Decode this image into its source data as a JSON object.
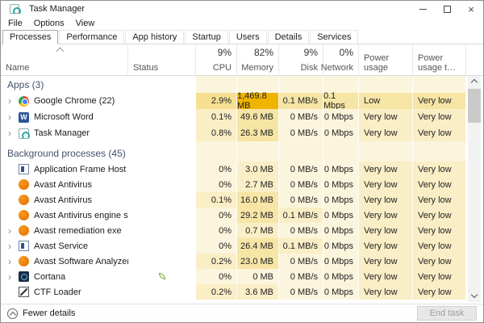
{
  "window": {
    "title": "Task Manager"
  },
  "menu": {
    "items": [
      "File",
      "Options",
      "View"
    ]
  },
  "tabs": [
    {
      "label": "Processes",
      "active": true
    },
    {
      "label": "Performance",
      "active": false
    },
    {
      "label": "App history",
      "active": false
    },
    {
      "label": "Startup",
      "active": false
    },
    {
      "label": "Users",
      "active": false
    },
    {
      "label": "Details",
      "active": false
    },
    {
      "label": "Services",
      "active": false
    }
  ],
  "columns": {
    "name": "Name",
    "status": "Status",
    "cpu": {
      "pct": "9%",
      "label": "CPU"
    },
    "memory": {
      "pct": "82%",
      "label": "Memory"
    },
    "disk": {
      "pct": "9%",
      "label": "Disk"
    },
    "network": {
      "pct": "0%",
      "label": "Network"
    },
    "power": "Power usage",
    "trend": "Power usage t…",
    "sort_column": "Name",
    "sort_direction": "ascending"
  },
  "colors": {
    "heat_base": "#FCF5DD",
    "heat_low": "#FAEEC6",
    "heat_medium": "#F7E5A6",
    "heat_high": "#F6DF92",
    "heat_max": "#EFB300",
    "section_title": "#44506B"
  },
  "sections": [
    {
      "title": "Apps (3)",
      "kind": "apps",
      "rows": [
        {
          "name": "Google Chrome (22)",
          "icon": "chrome-icon",
          "expandable": true,
          "status": "",
          "leaf": false,
          "cpu": "2.9%",
          "memory": "1,469.8 MB",
          "disk": "0.1 MB/s",
          "network": "0.1 Mbps",
          "power": "Low",
          "trend": "Very low",
          "heat": [
            3,
            4,
            2,
            2,
            2,
            2
          ]
        },
        {
          "name": "Microsoft Word",
          "icon": "word-icon",
          "expandable": true,
          "status": "",
          "leaf": false,
          "cpu": "0.1%",
          "memory": "49.6 MB",
          "disk": "0 MB/s",
          "network": "0 Mbps",
          "power": "Very low",
          "trend": "Very low",
          "heat": [
            1,
            2,
            0,
            0,
            1,
            1
          ]
        },
        {
          "name": "Task Manager",
          "icon": "taskmanager-icon",
          "expandable": true,
          "status": "",
          "leaf": false,
          "cpu": "0.8%",
          "memory": "26.3 MB",
          "disk": "0 MB/s",
          "network": "0 Mbps",
          "power": "Very low",
          "trend": "Very low",
          "heat": [
            1,
            2,
            0,
            0,
            1,
            1
          ]
        }
      ]
    },
    {
      "title": "Background processes (45)",
      "kind": "bg",
      "rows": [
        {
          "name": "Application Frame Host",
          "icon": "window-frame-icon",
          "expandable": false,
          "status": "",
          "leaf": false,
          "cpu": "0%",
          "memory": "3.0 MB",
          "disk": "0 MB/s",
          "network": "0 Mbps",
          "power": "Very low",
          "trend": "Very low",
          "heat": [
            0,
            1,
            0,
            0,
            1,
            1
          ]
        },
        {
          "name": "Avast Antivirus",
          "icon": "avast-icon",
          "expandable": false,
          "status": "",
          "leaf": false,
          "cpu": "0%",
          "memory": "2.7 MB",
          "disk": "0 MB/s",
          "network": "0 Mbps",
          "power": "Very low",
          "trend": "Very low",
          "heat": [
            0,
            1,
            0,
            0,
            1,
            1
          ]
        },
        {
          "name": "Avast Antivirus",
          "icon": "avast-icon",
          "expandable": false,
          "status": "",
          "leaf": false,
          "cpu": "0.1%",
          "memory": "16.0 MB",
          "disk": "0 MB/s",
          "network": "0 Mbps",
          "power": "Very low",
          "trend": "Very low",
          "heat": [
            1,
            2,
            0,
            0,
            1,
            1
          ]
        },
        {
          "name": "Avast Antivirus engine server",
          "icon": "avast-icon",
          "expandable": false,
          "status": "",
          "leaf": false,
          "cpu": "0%",
          "memory": "29.2 MB",
          "disk": "0.1 MB/s",
          "network": "0 Mbps",
          "power": "Very low",
          "trend": "Very low",
          "heat": [
            0,
            2,
            1,
            0,
            1,
            1
          ]
        },
        {
          "name": "Avast remediation exe",
          "icon": "avast-icon",
          "expandable": true,
          "status": "",
          "leaf": false,
          "cpu": "0%",
          "memory": "0.7 MB",
          "disk": "0 MB/s",
          "network": "0 Mbps",
          "power": "Very low",
          "trend": "Very low",
          "heat": [
            0,
            1,
            0,
            0,
            1,
            1
          ]
        },
        {
          "name": "Avast Service",
          "icon": "window-frame-icon",
          "expandable": true,
          "status": "",
          "leaf": false,
          "cpu": "0%",
          "memory": "26.4 MB",
          "disk": "0.1 MB/s",
          "network": "0 Mbps",
          "power": "Very low",
          "trend": "Very low",
          "heat": [
            0,
            2,
            1,
            0,
            1,
            1
          ]
        },
        {
          "name": "Avast Software Analyzer",
          "icon": "avast-icon",
          "expandable": true,
          "status": "",
          "leaf": false,
          "cpu": "0.2%",
          "memory": "23.0 MB",
          "disk": "0 MB/s",
          "network": "0 Mbps",
          "power": "Very low",
          "trend": "Very low",
          "heat": [
            1,
            2,
            0,
            0,
            1,
            1
          ]
        },
        {
          "name": "Cortana",
          "icon": "cortana-icon",
          "expandable": true,
          "status": "leaf",
          "leaf": true,
          "cpu": "0%",
          "memory": "0 MB",
          "disk": "0 MB/s",
          "network": "0 Mbps",
          "power": "Very low",
          "trend": "Very low",
          "heat": [
            0,
            0,
            0,
            0,
            1,
            1
          ]
        },
        {
          "name": "CTF Loader",
          "icon": "ctf-loader-icon",
          "expandable": false,
          "status": "",
          "leaf": false,
          "cpu": "0.2%",
          "memory": "3.6 MB",
          "disk": "0 MB/s",
          "network": "0 Mbps",
          "power": "Very low",
          "trend": "Very low",
          "heat": [
            1,
            1,
            0,
            0,
            1,
            1
          ]
        }
      ]
    }
  ],
  "footer": {
    "toggle_label": "Fewer details",
    "end_task_label": "End task"
  }
}
